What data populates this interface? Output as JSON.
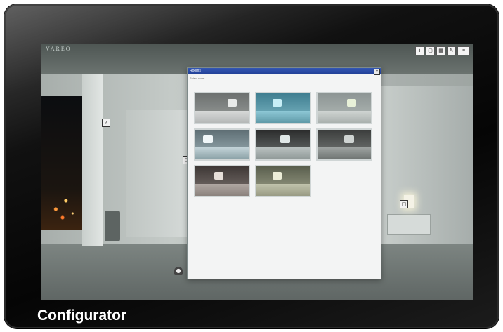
{
  "app": {
    "brand": "VAREO",
    "caption": "Configurator"
  },
  "toolbar": {
    "controls": [
      {
        "name": "info-icon",
        "glyph": "i"
      },
      {
        "name": "view-icon",
        "glyph": "▢"
      },
      {
        "name": "grid-icon",
        "glyph": "▦"
      },
      {
        "name": "edit-icon",
        "glyph": "✎"
      },
      {
        "name": "menu-icon",
        "glyph": "≡"
      }
    ]
  },
  "hotspots": [
    {
      "name": "hotspot-cabinet",
      "glyph": "?"
    },
    {
      "name": "hotspot-wall",
      "glyph": "□"
    },
    {
      "name": "hotspot-lamp",
      "glyph": "□"
    }
  ],
  "person": {
    "glyph": "●"
  },
  "dialog": {
    "title": "Rooms",
    "subtitle": "Select room",
    "close_glyph": "×",
    "thumbnails": [
      {
        "name": "room-thumb-1"
      },
      {
        "name": "room-thumb-2"
      },
      {
        "name": "room-thumb-3"
      },
      {
        "name": "room-thumb-4"
      },
      {
        "name": "room-thumb-5"
      },
      {
        "name": "room-thumb-6"
      },
      {
        "name": "room-thumb-7"
      },
      {
        "name": "room-thumb-8"
      }
    ]
  },
  "colors": {
    "titlebar": "#2a4aa5",
    "bezel": "#0a0a0a",
    "caption": "#ffffff"
  }
}
